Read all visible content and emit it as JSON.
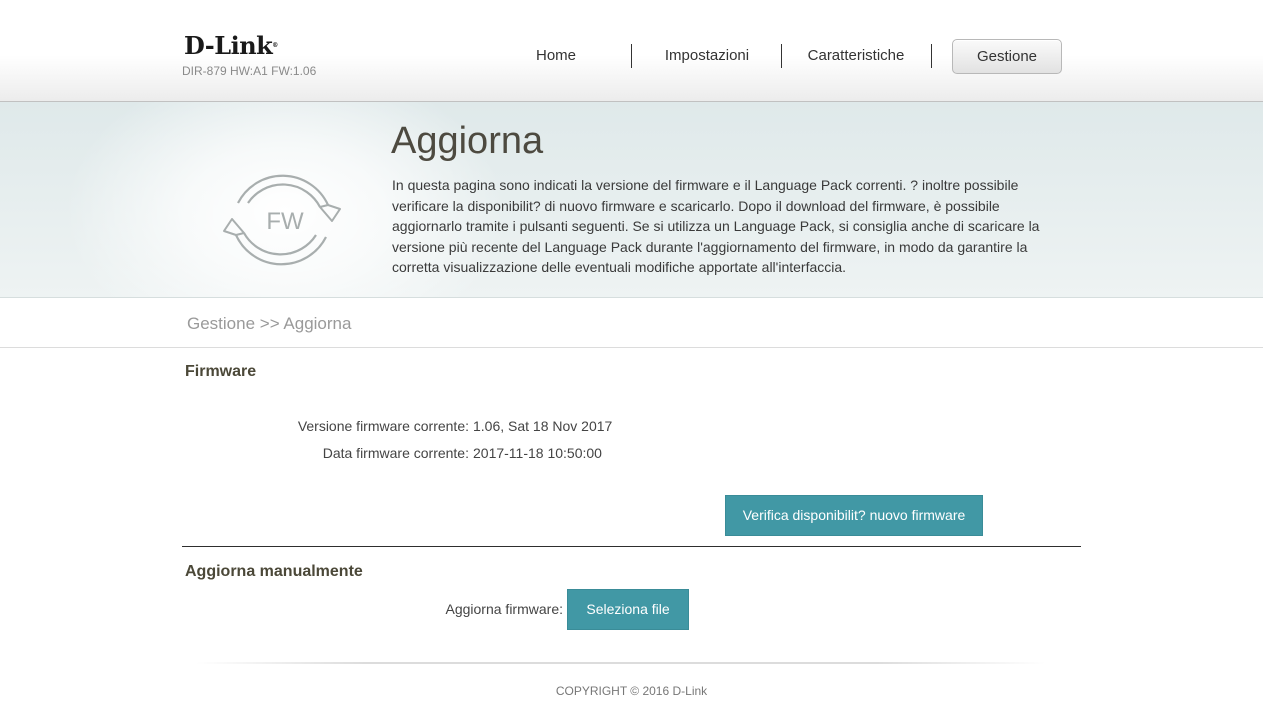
{
  "header": {
    "logo": "D-Link",
    "logo_mark": "®",
    "model": "DIR-879 HW:A1 FW:1.06",
    "nav": [
      {
        "label": "Home"
      },
      {
        "label": "Impostazioni"
      },
      {
        "label": "Caratteristiche"
      },
      {
        "label": "Gestione"
      }
    ],
    "active_nav": "Gestione"
  },
  "banner": {
    "icon_name": "firmware-update-icon",
    "icon_text": "FW",
    "title": "Aggiorna",
    "description": "In questa pagina sono indicati la versione del firmware e il Language Pack correnti. ? inoltre possibile verificare la disponibilit? di nuovo firmware e scaricarlo. Dopo il download del firmware, è possibile aggiornarlo tramite i pulsanti seguenti. Se si utilizza un Language Pack, si consiglia anche di scaricare la versione più recente del Language Pack durante l'aggiornamento del firmware, in modo da garantire la corretta visualizzazione delle eventuali modifiche apportate all'interfaccia."
  },
  "breadcrumb": "Gestione >> Aggiorna",
  "firmware": {
    "section_title": "Firmware",
    "version_label": "Versione firmware corrente:",
    "version_value": "1.06, Sat 18 Nov 2017",
    "date_label": "Data firmware corrente:",
    "date_value": "2017-11-18 10:50:00",
    "check_button": "Verifica disponibilit? nuovo firmware"
  },
  "manual": {
    "section_title": "Aggiorna manualmente",
    "upgrade_label": "Aggiorna firmware:",
    "select_button": "Seleziona file"
  },
  "footer": {
    "copyright": "COPYRIGHT © 2016 D-Link"
  },
  "colors": {
    "accent": "#4198a5",
    "banner_bg": "#dfe9ea",
    "title": "#4d4a40"
  }
}
